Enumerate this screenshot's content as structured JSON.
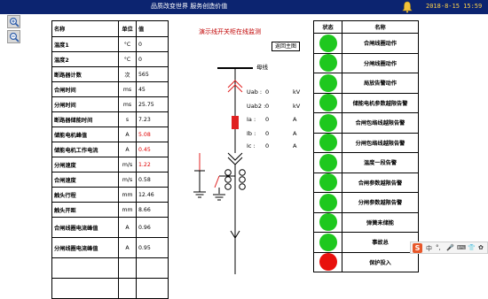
{
  "header": {
    "slogan": "品质改变世界 服务创造价值",
    "datetime": "2018-8-15 15:59",
    "bg_color": "#0c2470",
    "time_color": "#ffd24a"
  },
  "toolbar": {
    "zoom_in_icon": "zoom-in-icon",
    "zoom_out_icon": "zoom-out-icon"
  },
  "param_table": {
    "headers": [
      "名称",
      "单位",
      "值"
    ],
    "rows": [
      {
        "name": "温度1",
        "unit": "°C",
        "value": "0",
        "alarm": false
      },
      {
        "name": "温度2",
        "unit": "°C",
        "value": "0",
        "alarm": false
      },
      {
        "name": "断路器计数",
        "unit": "次",
        "value": "565",
        "alarm": false
      },
      {
        "name": "合闸时间",
        "unit": "ms",
        "value": "45",
        "alarm": false
      },
      {
        "name": "分闸时间",
        "unit": "ms",
        "value": "25.75",
        "alarm": false
      },
      {
        "name": "断路器储能时间",
        "unit": "s",
        "value": "7.23",
        "alarm": false
      },
      {
        "name": "储能电机峰值",
        "unit": "A",
        "value": "5.08",
        "alarm": true
      },
      {
        "name": "储能电机工作电流",
        "unit": "A",
        "value": "0.45",
        "alarm": true
      },
      {
        "name": "分闸速度",
        "unit": "m/s",
        "value": "1.22",
        "alarm": true
      },
      {
        "name": "合闸速度",
        "unit": "m/s",
        "value": "0.58",
        "alarm": false
      },
      {
        "name": "触头行程",
        "unit": "mm",
        "value": "12.46",
        "alarm": false
      },
      {
        "name": "触头开距",
        "unit": "mm",
        "value": "8.66",
        "alarm": false
      },
      {
        "name": "合闸线圈电流峰值",
        "unit": "A",
        "value": "0.96",
        "alarm": false
      },
      {
        "name": "分闸线圈电流峰值",
        "unit": "A",
        "value": "0.95",
        "alarm": false
      },
      {
        "name": "",
        "unit": "",
        "value": "",
        "alarm": false
      },
      {
        "name": "",
        "unit": "",
        "value": "",
        "alarm": false
      }
    ]
  },
  "diagram": {
    "title": "演示线开关柜在线监测",
    "return_button": "返回主图",
    "busbar_label": "母线",
    "measurements": [
      {
        "label": "Uab :",
        "value": "0",
        "unit": "kV"
      },
      {
        "label": "Uab2 :",
        "value": "0",
        "unit": "kV"
      },
      {
        "label": "Ia :",
        "value": "0",
        "unit": "A"
      },
      {
        "label": "Ib :",
        "value": "0",
        "unit": "A"
      },
      {
        "label": "Ic :",
        "value": "0",
        "unit": "A"
      }
    ],
    "breaker_color": "#e02020",
    "line_color": "#000000"
  },
  "status_table": {
    "headers": [
      "状态",
      "名称"
    ],
    "rows": [
      {
        "name": "合闸线圈动作",
        "state": "green"
      },
      {
        "name": "分闸线圈动作",
        "state": "green"
      },
      {
        "name": "局放告警动作",
        "state": "green"
      },
      {
        "name": "储能电机参数越限告警",
        "state": "green"
      },
      {
        "name": "合闸包络线越限告警",
        "state": "green"
      },
      {
        "name": "分闸包络线越限告警",
        "state": "green"
      },
      {
        "name": "温度一段告警",
        "state": "green"
      },
      {
        "name": "合闸参数越限告警",
        "state": "green"
      },
      {
        "name": "分闸参数越限告警",
        "state": "green"
      },
      {
        "name": "弹簧未储能",
        "state": "green"
      },
      {
        "name": "事故总",
        "state": "green"
      },
      {
        "name": "保护投入",
        "state": "red"
      }
    ],
    "colors": {
      "green": "#1ec81e",
      "red": "#e8100c"
    }
  },
  "floating_toolbar": {
    "logo": "S",
    "items": [
      "中",
      "°,",
      "🎤",
      "⌨",
      "👕",
      "✿"
    ]
  }
}
